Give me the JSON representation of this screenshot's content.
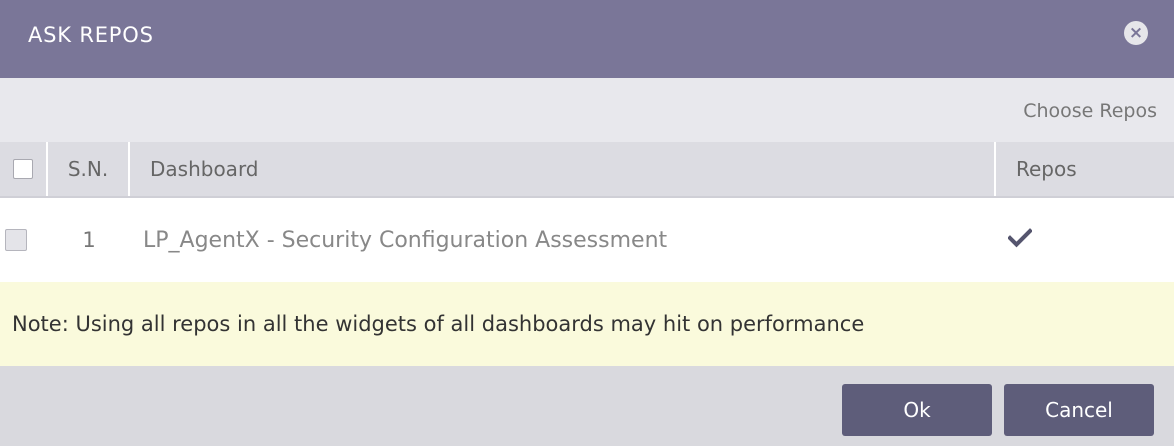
{
  "dialog": {
    "title": "ASK REPOS",
    "close_icon": "close-circle-icon"
  },
  "toolbar": {
    "choose_repos_label": "Choose Repos"
  },
  "table": {
    "columns": {
      "sn": "S.N.",
      "dashboard": "Dashboard",
      "repos": "Repos"
    },
    "rows": [
      {
        "sn": "1",
        "dashboard": "LP_AgentX - Security Configuration Assessment",
        "repos_checked": true,
        "repos_icon": "checkmark-icon"
      }
    ]
  },
  "note": {
    "text": "Note: Using all repos in all the widgets of all dashboards may hit on performance"
  },
  "footer": {
    "ok_label": "Ok",
    "cancel_label": "Cancel"
  },
  "colors": {
    "header_bg": "#7a7698",
    "button_bg": "#5e5d7a",
    "note_bg": "#fafadc"
  }
}
